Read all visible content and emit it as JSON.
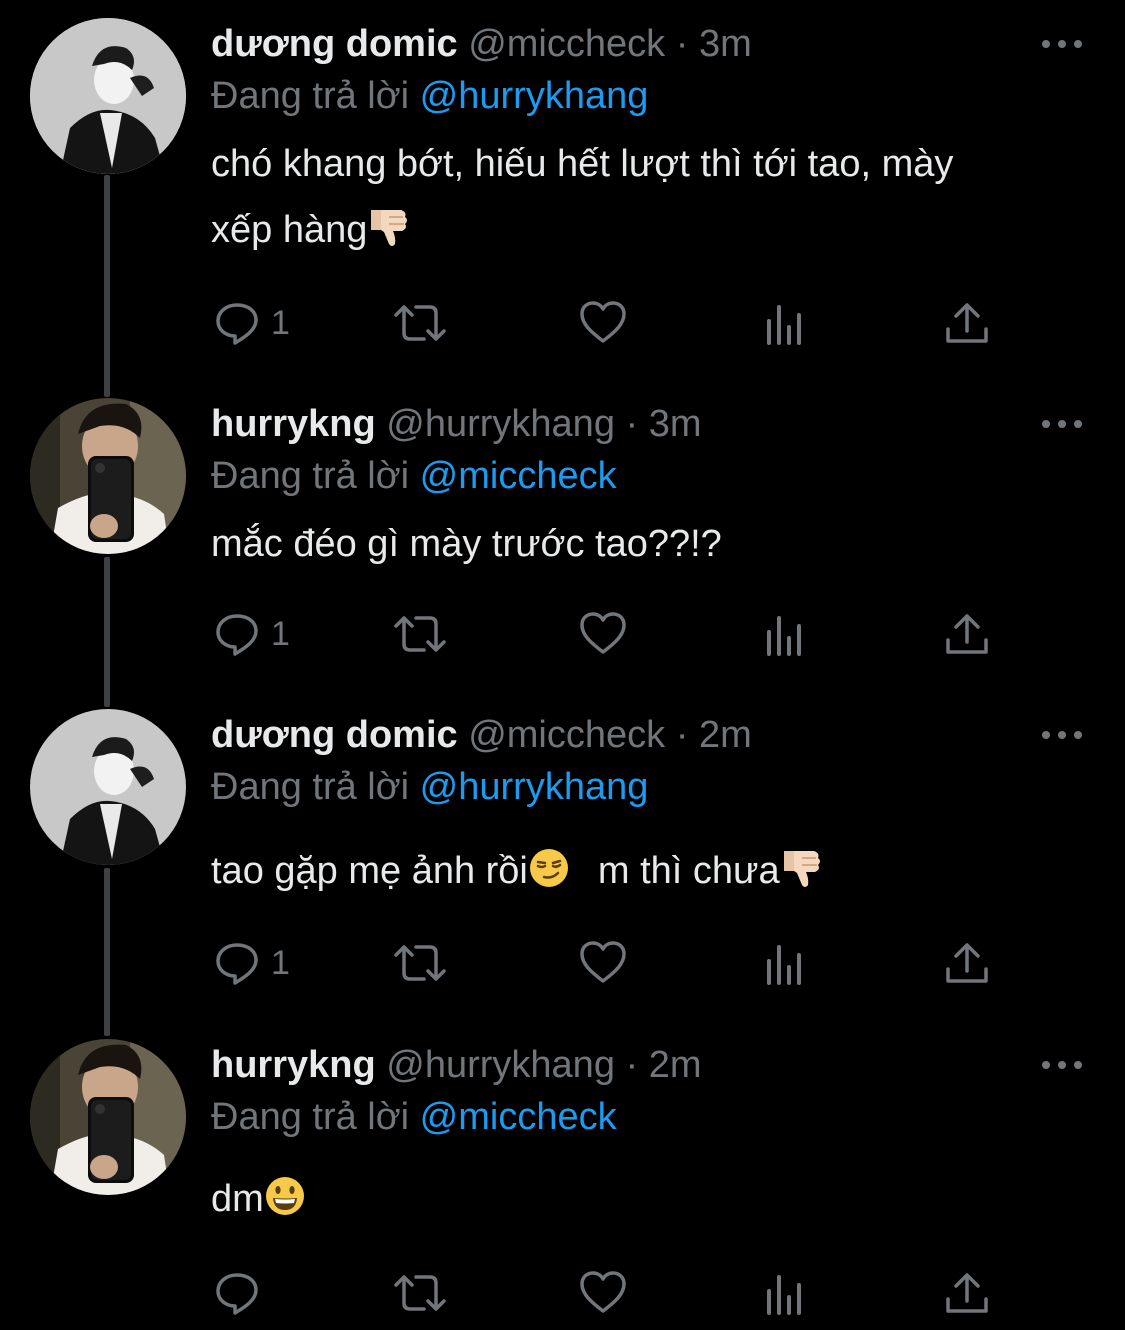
{
  "tweets": [
    {
      "name": "dương domic",
      "handle": "@miccheck",
      "dot": "·",
      "time": "3m",
      "reply_prefix": "Đang trả lời",
      "reply_to": "@hurrykhang",
      "text_line1": "chó khang bớt, hiếu hết lượt thì tới tao, mày",
      "text_line2": "xếp hàng",
      "reply_count": "1",
      "avatar_icon": "avatar-photo-miccheck"
    },
    {
      "name": "hurrykng",
      "handle": "@hurrykhang",
      "dot": "·",
      "time": "3m",
      "reply_prefix": "Đang trả lời",
      "reply_to": "@miccheck",
      "text": "mắc đéo gì mày trước tao??!?",
      "reply_count": "1",
      "avatar_icon": "avatar-photo-hurrykhang"
    },
    {
      "name": "dương domic",
      "handle": "@miccheck",
      "dot": "·",
      "time": "2m",
      "reply_prefix": "Đang trả lời",
      "reply_to": "@hurrykhang",
      "text_part1": "tao gặp mẹ ảnh rồi",
      "text_part2": "m thì chưa",
      "reply_count": "1",
      "avatar_icon": "avatar-photo-miccheck"
    },
    {
      "name": "hurrykng",
      "handle": "@hurrykhang",
      "dot": "·",
      "time": "2m",
      "reply_prefix": "Đang trả lời",
      "reply_to": "@miccheck",
      "text": "dm",
      "reply_count": "",
      "avatar_icon": "avatar-photo-hurrykhang"
    }
  ],
  "icons": {
    "more": "more-horizontal-icon",
    "reply": "reply-bubble-icon",
    "retweet": "retweet-icon",
    "like": "heart-icon",
    "views": "views-bar-chart-icon",
    "share": "share-upload-icon",
    "thumbs_down": "thumbs-down-emoji",
    "smirk": "smirking-face-emoji",
    "grin": "grinning-face-emoji"
  },
  "colors": {
    "background": "#000000",
    "primary_text": "#e7e9ea",
    "secondary_text": "#71767b",
    "link": "#1d9bf0",
    "thread_line": "#3e4144"
  }
}
